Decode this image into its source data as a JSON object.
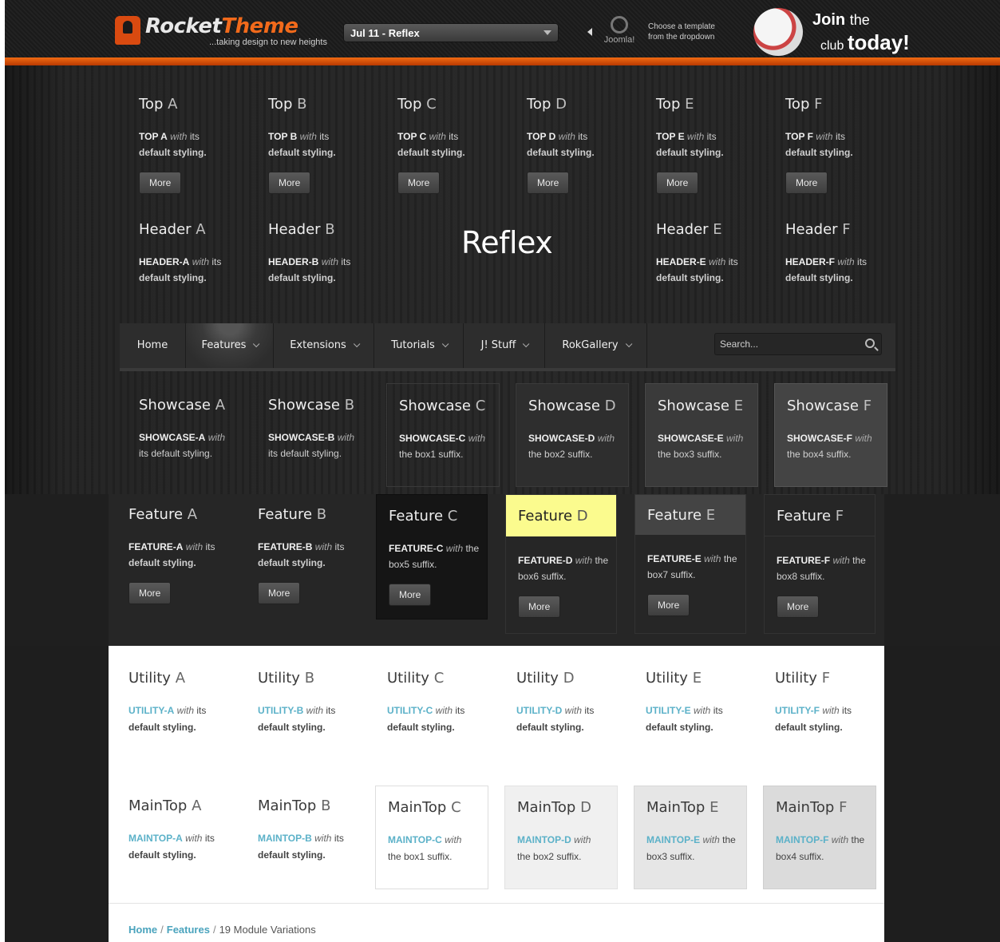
{
  "promo": {
    "logo_main": "Rocket",
    "logo_accent": "Theme",
    "logo_tagline": "...taking design to new heights",
    "template_select": "Jul 11 - Reflex",
    "joomla_label": "Joomla!",
    "choose_line1": "Choose a template",
    "choose_line2": "from the dropdown",
    "join_word": "Join",
    "join_the": "the",
    "join_club": "club",
    "join_today": "today!"
  },
  "top": [
    {
      "title_a": "Top",
      "title_b": "A",
      "key": "TOP A",
      "with": "with",
      "rest": "its",
      "line2": "default styling.",
      "more": "More"
    },
    {
      "title_a": "Top",
      "title_b": "B",
      "key": "TOP B",
      "with": "with",
      "rest": "its",
      "line2": "default styling.",
      "more": "More"
    },
    {
      "title_a": "Top",
      "title_b": "C",
      "key": "TOP C",
      "with": "with",
      "rest": "its",
      "line2": "default styling.",
      "more": "More"
    },
    {
      "title_a": "Top",
      "title_b": "D",
      "key": "TOP D",
      "with": "with",
      "rest": "its",
      "line2": "default styling.",
      "more": "More"
    },
    {
      "title_a": "Top",
      "title_b": "E",
      "key": "TOP E",
      "with": "with",
      "rest": "its",
      "line2": "default styling.",
      "more": "More"
    },
    {
      "title_a": "Top",
      "title_b": "F",
      "key": "TOP F",
      "with": "with",
      "rest": "its",
      "line2": "default styling.",
      "more": "More"
    }
  ],
  "header": [
    {
      "title_a": "Header",
      "title_b": "A",
      "key": "HEADER-A",
      "with": "with",
      "rest": "its",
      "line2": "default styling."
    },
    {
      "title_a": "Header",
      "title_b": "B",
      "key": "HEADER-B",
      "with": "with",
      "rest": "its",
      "line2": "default styling."
    },
    {
      "title_a": "Header",
      "title_b": "E",
      "key": "HEADER-E",
      "with": "with",
      "rest": "its",
      "line2": "default styling."
    },
    {
      "title_a": "Header",
      "title_b": "F",
      "key": "HEADER-F",
      "with": "with",
      "rest": "its",
      "line2": "default styling."
    }
  ],
  "site_logo": "Reflex",
  "nav": {
    "items": [
      "Home",
      "Features",
      "Extensions",
      "Tutorials",
      "J! Stuff",
      "RokGallery"
    ],
    "search_placeholder": "Search..."
  },
  "showcase": [
    {
      "title_a": "Showcase",
      "title_b": "A",
      "key": "SHOWCASE-A",
      "with": "with",
      "line2": "its default styling."
    },
    {
      "title_a": "Showcase",
      "title_b": "B",
      "key": "SHOWCASE-B",
      "with": "with",
      "line2": "its default styling."
    },
    {
      "title_a": "Showcase",
      "title_b": "C",
      "key": "SHOWCASE-C",
      "with": "with",
      "line2": "the box1 suffix."
    },
    {
      "title_a": "Showcase",
      "title_b": "D",
      "key": "SHOWCASE-D",
      "with": "with",
      "line2": "the box2 suffix."
    },
    {
      "title_a": "Showcase",
      "title_b": "E",
      "key": "SHOWCASE-E",
      "with": "with",
      "line2": "the box3 suffix."
    },
    {
      "title_a": "Showcase",
      "title_b": "F",
      "key": "SHOWCASE-F",
      "with": "with",
      "line2": "the box4 suffix."
    }
  ],
  "feature": [
    {
      "title_a": "Feature",
      "title_b": "A",
      "key": "FEATURE-A",
      "with": "with",
      "rest": "its",
      "line2": "default styling.",
      "more": "More"
    },
    {
      "title_a": "Feature",
      "title_b": "B",
      "key": "FEATURE-B",
      "with": "with",
      "rest": "its",
      "line2": "default styling.",
      "more": "More"
    },
    {
      "title_a": "Feature",
      "title_b": "C",
      "key": "FEATURE-C",
      "with": "with",
      "rest": "the",
      "line2": "box5 suffix.",
      "more": "More"
    },
    {
      "title_a": "Feature",
      "title_b": "D",
      "key": "FEATURE-D",
      "with": "with",
      "rest": "the",
      "line2": "box6 suffix.",
      "more": "More"
    },
    {
      "title_a": "Feature",
      "title_b": "E",
      "key": "FEATURE-E",
      "with": "with",
      "rest": "the",
      "line2": "box7 suffix.",
      "more": "More"
    },
    {
      "title_a": "Feature",
      "title_b": "F",
      "key": "FEATURE-F",
      "with": "with",
      "rest": "the",
      "line2": "box8 suffix.",
      "more": "More"
    }
  ],
  "utility": [
    {
      "title_a": "Utility",
      "title_b": "A",
      "key": "UTILITY-A",
      "with": "with",
      "rest": "its",
      "line2": "default styling."
    },
    {
      "title_a": "Utility",
      "title_b": "B",
      "key": "UTILITY-B",
      "with": "with",
      "rest": "its",
      "line2": "default styling."
    },
    {
      "title_a": "Utility",
      "title_b": "C",
      "key": "UTILITY-C",
      "with": "with",
      "rest": "its",
      "line2": "default styling."
    },
    {
      "title_a": "Utility",
      "title_b": "D",
      "key": "UTILITY-D",
      "with": "with",
      "rest": "its",
      "line2": "default styling."
    },
    {
      "title_a": "Utility",
      "title_b": "E",
      "key": "UTILITY-E",
      "with": "with",
      "rest": "its",
      "line2": "default styling."
    },
    {
      "title_a": "Utility",
      "title_b": "F",
      "key": "UTILITY-F",
      "with": "with",
      "rest": "its",
      "line2": "default styling."
    }
  ],
  "maintop": [
    {
      "title_a": "MainTop",
      "title_b": "A",
      "key": "MAINTOP-A",
      "with": "with",
      "rest": "its",
      "line2": "default styling."
    },
    {
      "title_a": "MainTop",
      "title_b": "B",
      "key": "MAINTOP-B",
      "with": "with",
      "rest": "its",
      "line2": "default styling."
    },
    {
      "title_a": "MainTop",
      "title_b": "C",
      "key": "MAINTOP-C",
      "with": "with",
      "rest": "",
      "line2": "the box1 suffix."
    },
    {
      "title_a": "MainTop",
      "title_b": "D",
      "key": "MAINTOP-D",
      "with": "with",
      "rest": "",
      "line2": "the box2 suffix."
    },
    {
      "title_a": "MainTop",
      "title_b": "E",
      "key": "MAINTOP-E",
      "with": "with",
      "rest": "the",
      "line2": "box3 suffix."
    },
    {
      "title_a": "MainTop",
      "title_b": "F",
      "key": "MAINTOP-F",
      "with": "with",
      "rest": "the",
      "line2": "box4 suffix."
    }
  ],
  "breadcrumb": {
    "home": "Home",
    "features": "Features",
    "sep": "/",
    "current": "19 Module Variations"
  },
  "colors": {
    "accent_orange": "#f26a1b",
    "feature_d_yellow": "#fbfb8e",
    "utility_link": "#5bb1c8"
  }
}
